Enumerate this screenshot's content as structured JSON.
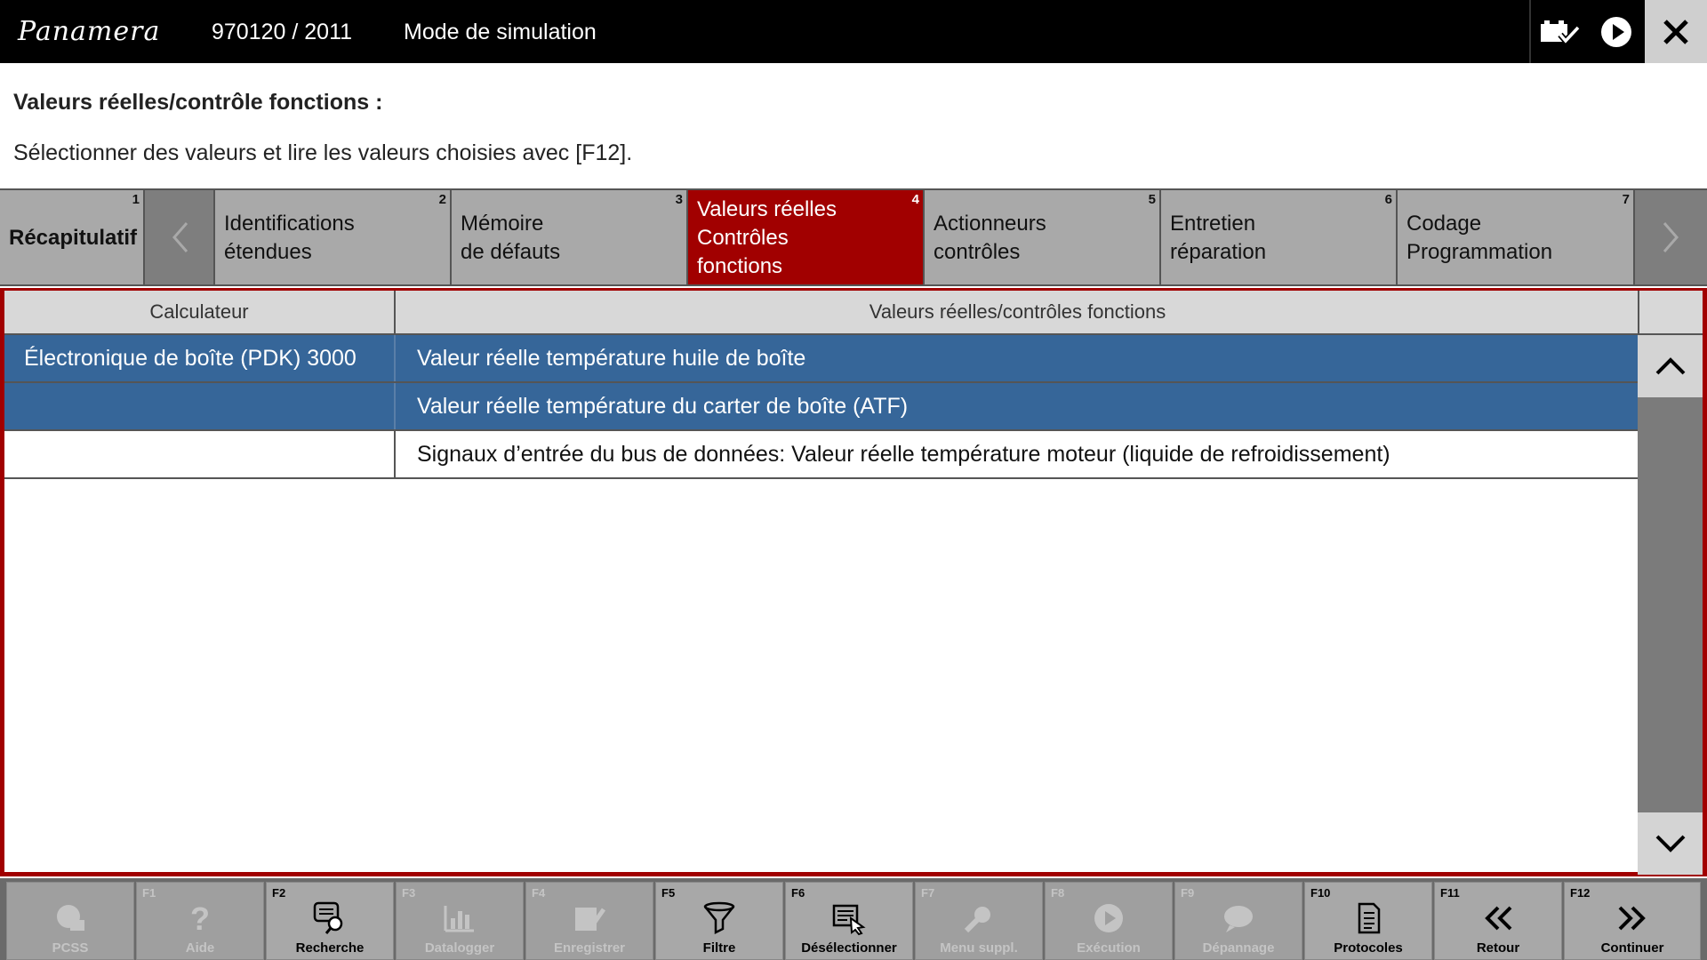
{
  "header": {
    "logo": "Panamera",
    "vehicle": "970120 / 2011",
    "mode": "Mode de simulation"
  },
  "headline": "Valeurs réelles/contrôle fonctions :",
  "subline": "Sélectionner des valeurs et lire les valeurs choisies avec [F12].",
  "tabs": [
    {
      "num": "1",
      "label": "Récapitulatif"
    },
    {
      "num": "2",
      "label": "Identifications\nétendues"
    },
    {
      "num": "3",
      "label": "Mémoire\nde défauts"
    },
    {
      "num": "4",
      "label": "Valeurs réelles\nContrôles\nfonctions",
      "active": true
    },
    {
      "num": "5",
      "label": "Actionneurs\ncontrôles"
    },
    {
      "num": "6",
      "label": "Entretien\nréparation"
    },
    {
      "num": "7",
      "label": "Codage\nProgrammation"
    }
  ],
  "table": {
    "headers": [
      "Calculateur",
      "Valeurs réelles/contrôles fonctions"
    ],
    "rows": [
      {
        "ecu": "Électronique de boîte (PDK) 3000",
        "value": "Valeur réelle température huile de boîte",
        "selected": true
      },
      {
        "ecu": "",
        "value": "Valeur réelle température du carter de boîte (ATF)",
        "selected": true
      },
      {
        "ecu": "",
        "value": "Signaux d’entrée du bus de données: Valeur réelle température moteur (liquide de refroidissement)",
        "selected": false
      }
    ]
  },
  "fkeys": [
    {
      "key": "",
      "label": "PCSS",
      "icon": "pcss-icon",
      "enabled": false
    },
    {
      "key": "F1",
      "label": "Aide",
      "icon": "help-icon",
      "enabled": false
    },
    {
      "key": "F2",
      "label": "Recherche",
      "icon": "search-icon",
      "enabled": true
    },
    {
      "key": "F3",
      "label": "Datalogger",
      "icon": "datalogger-icon",
      "enabled": false
    },
    {
      "key": "F4",
      "label": "Enregistrer",
      "icon": "save-icon",
      "enabled": false
    },
    {
      "key": "F5",
      "label": "Filtre",
      "icon": "filter-icon",
      "enabled": true
    },
    {
      "key": "F6",
      "label": "Désélectionner",
      "icon": "deselect-icon",
      "enabled": true
    },
    {
      "key": "F7",
      "label": "Menu suppl.",
      "icon": "extra-menu-icon",
      "enabled": false
    },
    {
      "key": "F8",
      "label": "Exécution",
      "icon": "execute-icon",
      "enabled": false
    },
    {
      "key": "F9",
      "label": "Dépannage",
      "icon": "troubleshoot-icon",
      "enabled": false
    },
    {
      "key": "F10",
      "label": "Protocoles",
      "icon": "protocols-icon",
      "enabled": true
    },
    {
      "key": "F11",
      "label": "Retour",
      "icon": "back-icon",
      "enabled": true
    },
    {
      "key": "F12",
      "label": "Continuer",
      "icon": "continue-icon",
      "enabled": true
    }
  ],
  "colors": {
    "accent": "#a10000",
    "selection": "#366699",
    "header_bg": "#000000"
  }
}
